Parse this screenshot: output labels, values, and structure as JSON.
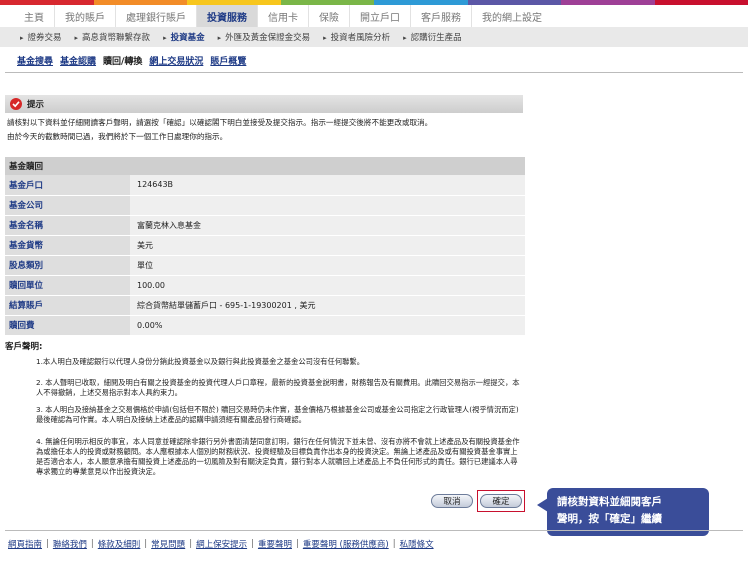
{
  "colors": {
    "strip": [
      "#d7282f",
      "#f28c28",
      "#f7c61d",
      "#7ab648",
      "#2e9ad6",
      "#5b57a6",
      "#9e3f96",
      "#c8102e"
    ],
    "brand_blue": "#1f3b86",
    "callout": "#3a4d99"
  },
  "main_nav": [
    {
      "label": "主頁",
      "active": false
    },
    {
      "label": "我的賬戶",
      "active": false
    },
    {
      "label": "處理銀行賬戶",
      "active": false
    },
    {
      "label": "投資服務",
      "active": true
    },
    {
      "label": "信用卡",
      "active": false
    },
    {
      "label": "保險",
      "active": false
    },
    {
      "label": "開立戶口",
      "active": false
    },
    {
      "label": "客戶服務",
      "active": false
    },
    {
      "label": "我的網上設定",
      "active": false
    }
  ],
  "sub_nav": [
    {
      "label": "證券交易",
      "active": false
    },
    {
      "label": "高息貨幣聯繫存款",
      "active": false
    },
    {
      "label": "投資基金",
      "active": true
    },
    {
      "label": "外匯及黃金保證金交易",
      "active": false
    },
    {
      "label": "投資者風險分析",
      "active": false
    },
    {
      "label": "認購衍生產品",
      "active": false
    }
  ],
  "tertiary_nav": [
    {
      "label": "基金搜尋",
      "current": false
    },
    {
      "label": "基金認購",
      "current": false
    },
    {
      "label": "贖回/轉換",
      "current": true
    },
    {
      "label": "網上交易狀況",
      "current": false
    },
    {
      "label": "賬戶概覽",
      "current": false
    }
  ],
  "notice": {
    "title": "提示",
    "line1": "請核對以下資料並仔細閱讀客戶聲明，請選按「確認」以確認閣下明白並接受及提交指示。指示一經提交後將不能更改或取消。",
    "line2": "由於今天的截數時間已過，我們將於下一個工作日處理你的指示。"
  },
  "fund": {
    "header": "基金贖回",
    "rows": [
      {
        "label": "基金戶口",
        "value": "124643B"
      },
      {
        "label": "基金公司",
        "value": ""
      },
      {
        "label": "基金名稱",
        "value": "富蘭克林入息基金"
      },
      {
        "label": "基金貨幣",
        "value": "美元"
      },
      {
        "label": "股息類別",
        "value": "單位"
      },
      {
        "label": "贖回單位",
        "value": "100.00"
      },
      {
        "label": "結算賬戶",
        "value": "綜合貨幣結單儲蓄戶口 - 695-1-19300201 , 美元"
      },
      {
        "label": "贖回費",
        "value": "0.00%"
      }
    ]
  },
  "declaration": {
    "title": "客戶聲明:",
    "items": [
      "1.本人明白及確認銀行以代理人身份分銷此投資基金以及銀行與此投資基金之基金公司沒有任何聯繫。",
      "2. 本人聲明已收取，細閱及明白有關之投資基金的投資代理人戶口章程，最新的投資基金說明書，財務報告及有關費用。此贖回交易指示一經提交，本人不得撤銷，上述交易指示對本人具約束力。",
      "3. 本人明白及接納基金之交易價格於申請(包括但不限於) 贖回交易時仍未作實，基金價格乃根據基金公司或基金公司指定之行政管理人(視乎情況而定) 最後確認為可作實。本人明白及接納上述產品的認購申請須經有關產品發行商確認。",
      "4. 無論任何明示相反的事宜，本人同意並確認除非銀行另外書面清楚同意訂明，銀行在任何情況下並未曾、沒有亦將不會就上述產品及有關投資基金作為或擔任本人的投資或財務顧問。本人應根據本人個別的財務狀況、投資經驗及目標負責作出本身的投資決定。無論上述產品及或有關投資基金事實上是否適合本人，本人願意承擔有關投資上述產品的一切風險及對有關決定負責，銀行對本人就贖回上述產品上不負任何形式的責任。銀行已建議本人尋專求獨立的專業意見以作出投資決定。"
    ]
  },
  "buttons": {
    "cancel": "取消",
    "confirm": "確定"
  },
  "callout": {
    "line1": "請核對資料並細閱客戶",
    "line2": "聲明，按「確定」繼續"
  },
  "footer": [
    "網頁指南",
    "聯絡我們",
    "條款及細則",
    "常見問題",
    "網上保安提示",
    "重要聲明",
    "重要聲明 (服務供應商)",
    "私隱條文"
  ]
}
